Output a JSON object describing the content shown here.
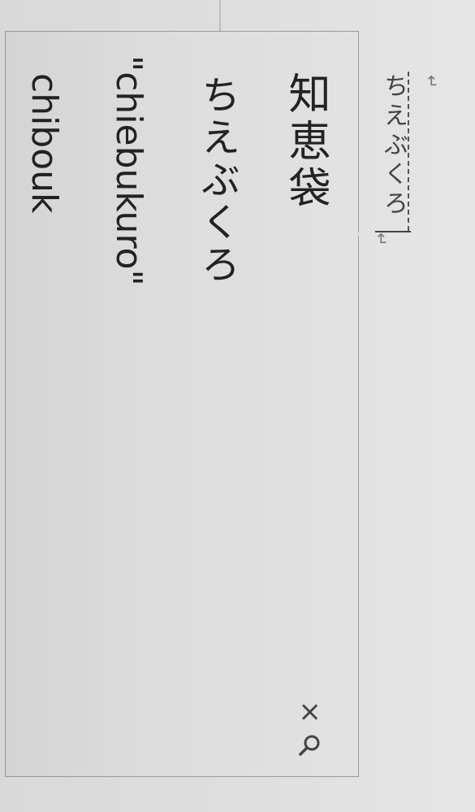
{
  "composition": {
    "text": "ちえぶくろ"
  },
  "candidates": [
    {
      "text": "知恵袋"
    },
    {
      "text": "ちえぶくろ"
    },
    {
      "text": "\"chiebukuro\""
    },
    {
      "text": "chibouk"
    }
  ],
  "controls": {
    "close_symbol": "×"
  },
  "marks": {
    "return_symbol": "↵"
  }
}
